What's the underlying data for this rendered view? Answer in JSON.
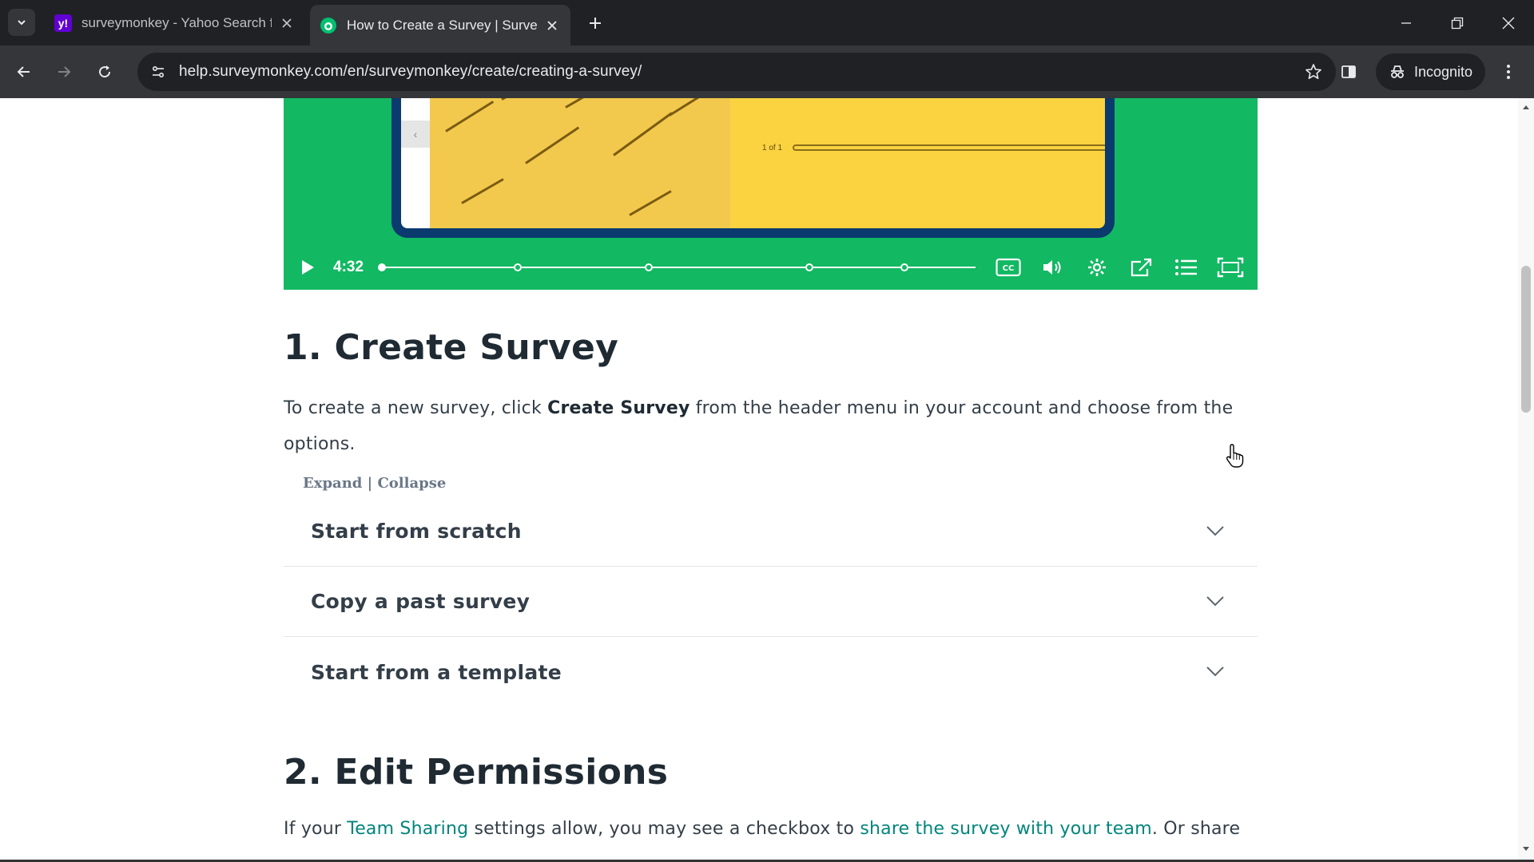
{
  "browser": {
    "tabs": [
      {
        "title": "surveymonkey - Yahoo Search f",
        "favicon": "yahoo-icon",
        "favicon_text": "y!",
        "favicon_color": "#6001d2",
        "active": false
      },
      {
        "title": "How to Create a Survey | Surve",
        "favicon": "surveymonkey-icon",
        "favicon_color": "#00bf6f",
        "active": true
      }
    ],
    "url": "help.surveymonkey.com/en/surveymonkey/create/creating-a-survey/",
    "incognito_label": "Incognito"
  },
  "video": {
    "time": "4:32",
    "page_count": "1 of 1",
    "progress": 0.0,
    "chapter_fractions": [
      0.23,
      0.45,
      0.72,
      0.88
    ]
  },
  "section1": {
    "heading": "1. Create Survey",
    "para_part1": "To create a new survey, click ",
    "para_bold": "Create Survey",
    "para_part2": " from the header menu in your account and choose from the options.",
    "expand": "Expand",
    "separator": " | ",
    "collapse": "Collapse",
    "accordion": [
      {
        "label": "Start from scratch"
      },
      {
        "label": "Copy a past survey"
      },
      {
        "label": "Start from a template"
      }
    ]
  },
  "section2": {
    "heading": "2. Edit Permissions",
    "para_part1": "If your ",
    "link1": "Team Sharing",
    "para_part2": " settings allow, you may see a checkbox to ",
    "link2": "share the survey with your team",
    "para_part3": ". Or share"
  },
  "colors": {
    "brand_green": "#12b862",
    "link": "#00857c",
    "heading": "#1f2a33"
  }
}
